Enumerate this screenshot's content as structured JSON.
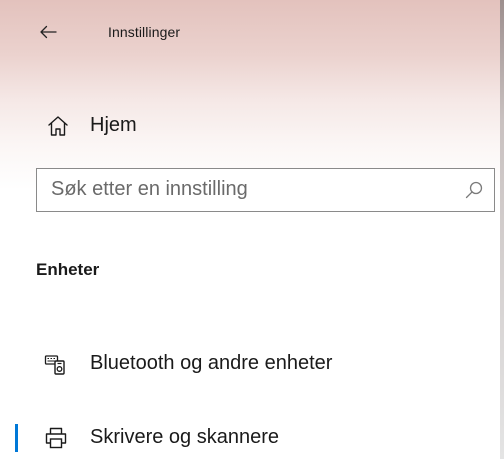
{
  "window": {
    "title": "Innstillinger"
  },
  "nav": {
    "back_icon": "arrow-left-icon",
    "home": {
      "label": "Hjem",
      "icon": "home-icon"
    }
  },
  "search": {
    "value": "",
    "placeholder": "Søk etter en innstilling",
    "icon": "search-icon"
  },
  "section": {
    "heading": "Enheter"
  },
  "items": [
    {
      "label": "Bluetooth og andre enheter",
      "icon": "bluetooth-devices-icon",
      "selected": false
    },
    {
      "label": "Skrivere og skannere",
      "icon": "printer-icon",
      "selected": true
    }
  ],
  "colors": {
    "accent": "#0078d7",
    "titlebar_tint": "#e3c2bd",
    "text": "#1a1a1a"
  }
}
